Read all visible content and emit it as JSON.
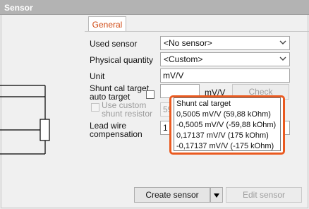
{
  "window": {
    "title": "Sensor"
  },
  "tabs": [
    {
      "label": "General",
      "active": true
    }
  ],
  "form": {
    "used_sensor": {
      "label": "Used sensor",
      "value": "<No sensor>"
    },
    "physical_quantity": {
      "label": "Physical quantity",
      "value": "<Custom>"
    },
    "unit": {
      "label": "Unit",
      "value": "mV/V"
    },
    "shunt_cal_target": {
      "label_line1": "Shunt cal target",
      "label_line2": "auto target",
      "unit": "mV/V",
      "check_label": "Check"
    },
    "use_custom_shunt": {
      "label_line1": "Use custom",
      "label_line2": "shunt resistor",
      "value_partial": "59"
    },
    "lead_wire": {
      "label_line1": "Lead wire",
      "label_line2": "compensation",
      "value_partial": "1"
    }
  },
  "dropdown": {
    "header": "Shunt cal target",
    "options": [
      "0,5005 mV/V (59,88 kOhm)",
      "-0,5005 mV/V (-59,88 kOhm)",
      "0,17137 mV/V (175 kOhm)",
      "-0,17137 mV/V (-175 kOhm)"
    ],
    "highlight_color": "#ea5a20"
  },
  "actions": {
    "create_sensor": "Create sensor",
    "edit_sensor": "Edit sensor"
  },
  "colors": {
    "accent": "#d04a14",
    "title_bar": "#b3b3b3"
  }
}
